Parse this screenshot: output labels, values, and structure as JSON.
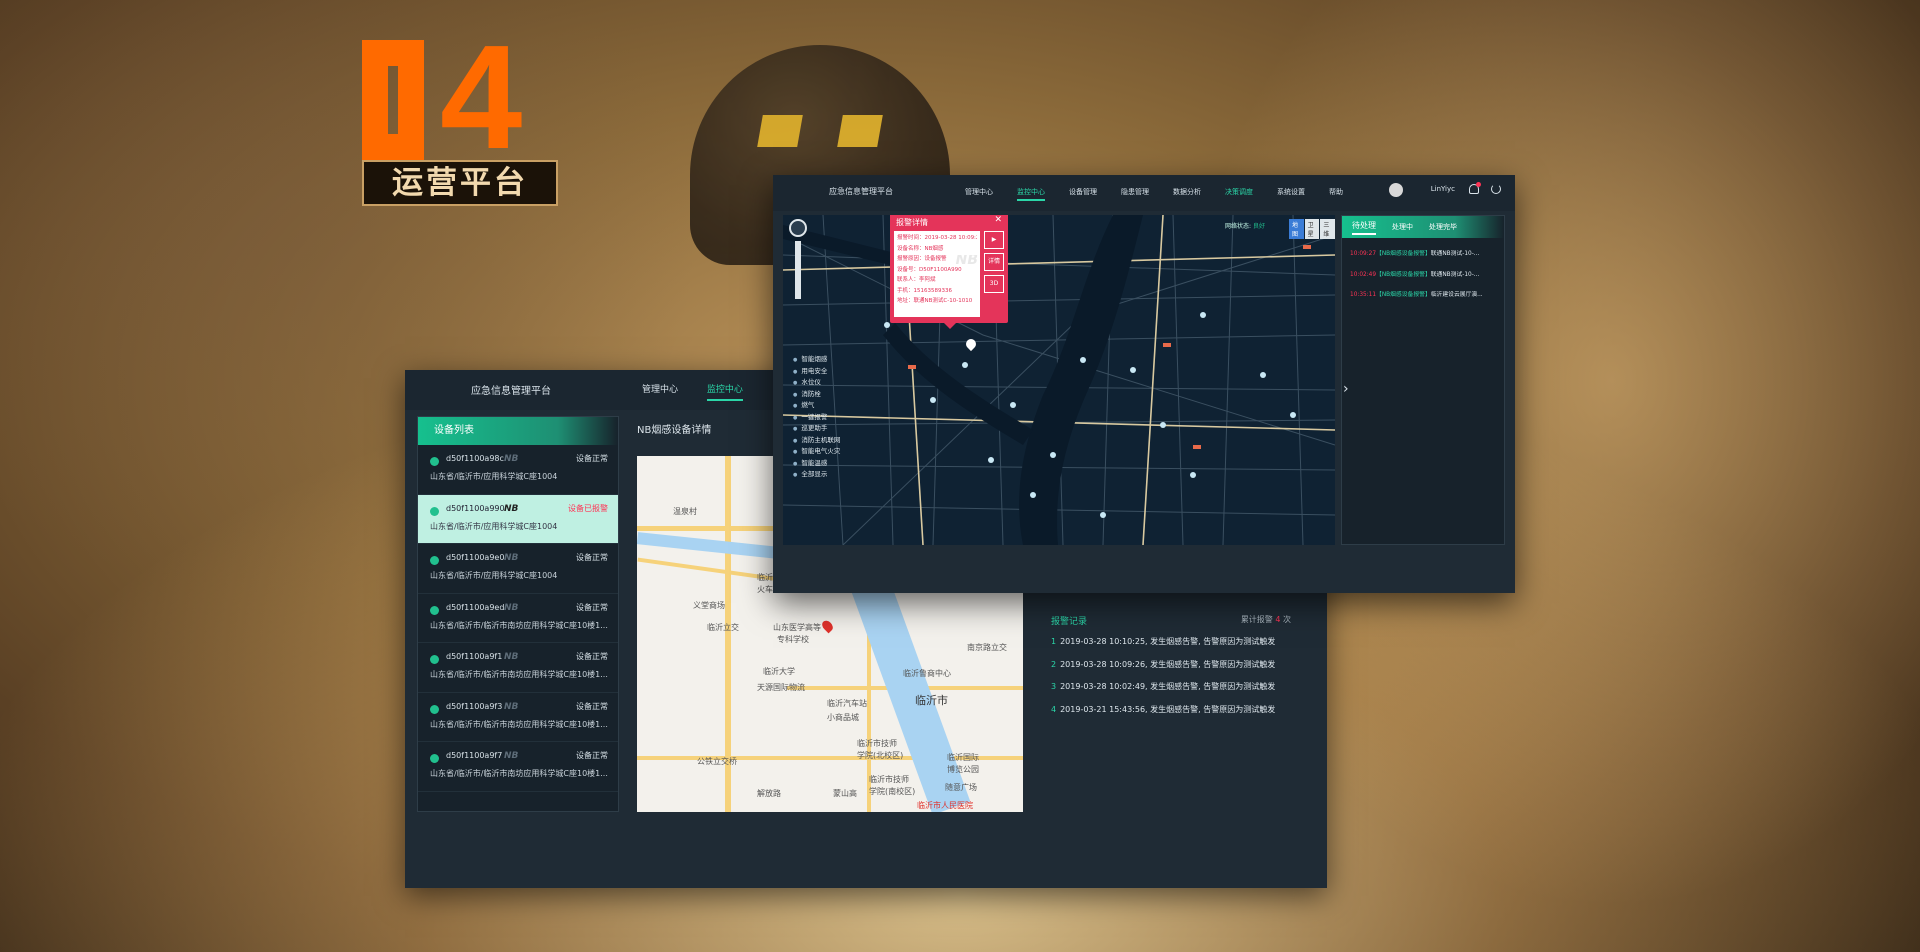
{
  "hero": {
    "number": "4",
    "title": "运营平台"
  },
  "back_window": {
    "logo": "应急信息管理平台",
    "nav": [
      "管理中心",
      "监控中心"
    ],
    "active_nav": "监控中心",
    "device_panel_title": "设备列表",
    "devices": [
      {
        "code": "d50f1100a98c",
        "nb": "NB",
        "status": "设备正常",
        "addr": "山东省/临沂市/应用科学城C座1004"
      },
      {
        "code": "d50f1100a990",
        "nb": "NB",
        "status": "设备已报警",
        "addr": "山东省/临沂市/应用科学城C座1004"
      },
      {
        "code": "d50f1100a9e0",
        "nb": "NB",
        "status": "设备正常",
        "addr": "山东省/临沂市/应用科学城C座1004"
      },
      {
        "code": "d50f1100a9ed",
        "nb": "NB",
        "status": "设备正常",
        "addr": "山东省/临沂市/临沂市南坊应用科学城C座10楼1..."
      },
      {
        "code": "d50f1100a9f1",
        "nb": "NB",
        "status": "设备正常",
        "addr": "山东省/临沂市/临沂市南坊应用科学城C座10楼1..."
      },
      {
        "code": "d50f1100a9f3",
        "nb": "NB",
        "status": "设备正常",
        "addr": "山东省/临沂市/临沂市南坊应用科学城C座10楼1..."
      },
      {
        "code": "d50f1100a9f7",
        "nb": "NB",
        "status": "设备正常",
        "addr": "山东省/临沂市/临沂市南坊应用科学城C座10楼1..."
      }
    ],
    "detail_title": "NB烟感设备详情",
    "map_labels": {
      "l1": "温泉村",
      "l2": "临沂市宝苏",
      "l3": "火车站",
      "l4": "义堂商场",
      "l5": "临沂立交",
      "l6": "山东医学高等",
      "l7": "专科学校",
      "l8": "临沂大学",
      "l9": "天源国际物流",
      "l10": "临沂鲁商中心",
      "l11": "临沂市",
      "l12": "南京路立交",
      "l13": "临沂汽车站",
      "l14": "小商品城",
      "l15": "临沂市技师",
      "l16": "学院(北校区)",
      "l17": "公铁立交桥",
      "l18": "临沂市技师",
      "l19": "学院(南校区)",
      "l20": "临沂国际",
      "l21": "博览公园",
      "l22": "解放路",
      "l23": "蒙山高",
      "l24": "临沂市人民医院",
      "l25": "随意广场"
    },
    "alarm": {
      "title": "报警记录",
      "count_prefix": "累计报警",
      "count": "4",
      "count_suffix": "次",
      "records": [
        {
          "idx": "1",
          "text": "2019-03-28 10:10:25, 发生烟感告警, 告警原因为测试触发"
        },
        {
          "idx": "2",
          "text": "2019-03-28 10:09:26, 发生烟感告警, 告警原因为测试触发"
        },
        {
          "idx": "3",
          "text": "2019-03-28 10:02:49, 发生烟感告警, 告警原因为测试触发"
        },
        {
          "idx": "4",
          "text": "2019-03-21 15:43:56, 发生烟感告警, 告警原因为测试触发"
        }
      ]
    }
  },
  "front_window": {
    "logo": "应急信息管理平台",
    "nav": [
      "管理中心",
      "监控中心",
      "设备管理",
      "隐患管理",
      "数据分析",
      "决策调度",
      "系统设置",
      "帮助"
    ],
    "active_nav": "监控中心",
    "user": "LinYiyc",
    "net_status_label": "网络状态:",
    "net_status_value": "良好",
    "map_types": [
      "地图",
      "卫星",
      "三维"
    ],
    "map_type_selected": "地图",
    "legend": [
      "智能烟感",
      "用电安全",
      "水位仪",
      "消防栓",
      "燃气",
      "一键报警",
      "巡更助手",
      "消防主机联网",
      "智能电气火灾",
      "智能温感",
      "全部显示"
    ],
    "popup": {
      "title": "报警详情",
      "lines": [
        "报警时间：2019-03-28 10:09:27",
        "设备名称：NB烟感",
        "报警原因：设备报警",
        "设备号：D50F1100A990",
        "联系人：李阿斌",
        "手机：15163589336",
        "地址：联通NB测试C-10-1010"
      ],
      "watermark": "NB",
      "btn_detail": "详情",
      "btn_3d": "3D"
    },
    "todo": {
      "tabs": [
        "待处理",
        "处理中",
        "处理完毕"
      ],
      "active": "待处理",
      "items": [
        {
          "time": "10:09:27",
          "kind": "【NB烟感设备报警】",
          "desc": "联通NB测试-10-..."
        },
        {
          "time": "10:02:49",
          "kind": "【NB烟感设备报警】",
          "desc": "联通NB测试-10-..."
        },
        {
          "time": "10:35:11",
          "kind": "【NB烟感设备报警】",
          "desc": "临沂建设云展厅演..."
        }
      ]
    }
  }
}
